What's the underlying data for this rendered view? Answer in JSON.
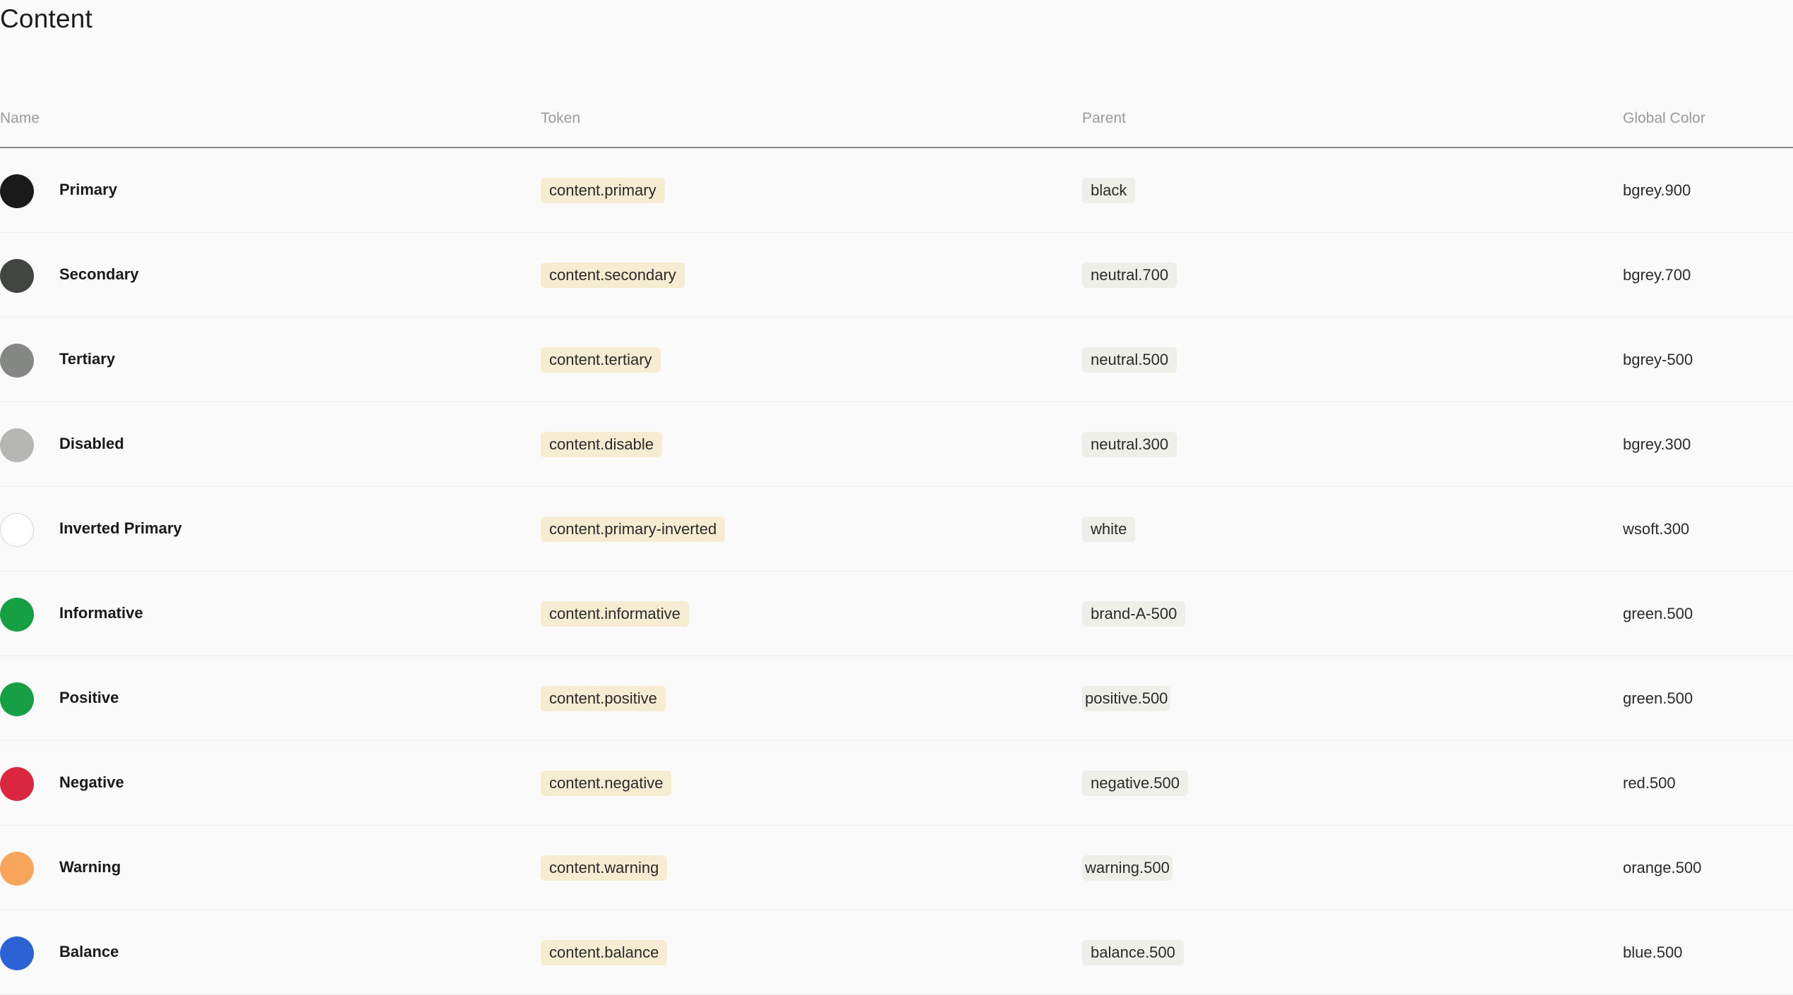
{
  "page": {
    "title": "Content"
  },
  "columns": {
    "name": "Name",
    "token": "Token",
    "parent": "Parent",
    "global": "Global Color"
  },
  "rows": [
    {
      "name": "Primary",
      "token": "content.primary",
      "parent": "black",
      "global": "bgrey.900",
      "swatch": "#1a1a1a"
    },
    {
      "name": "Secondary",
      "token": "content.secondary",
      "parent": "neutral.700",
      "global": "bgrey.700",
      "swatch": "#434543"
    },
    {
      "name": "Tertiary",
      "token": "content.tertiary",
      "parent": "neutral.500",
      "global": "bgrey-500",
      "swatch": "#858784"
    },
    {
      "name": "Disabled",
      "token": "content.disable",
      "parent": "neutral.300",
      "global": "bgrey.300",
      "swatch": "#b6b7b4"
    },
    {
      "name": "Inverted Primary",
      "token": "content.primary-inverted",
      "parent": "white",
      "global": "wsoft.300",
      "swatch": "#ffffff"
    },
    {
      "name": "Informative",
      "token": "content.informative",
      "parent": "brand-A-500",
      "global": "green.500",
      "swatch": "#16a043"
    },
    {
      "name": "Positive",
      "token": "content.positive",
      "parent": "positive.500",
      "global": "green.500",
      "swatch": "#16a043"
    },
    {
      "name": "Negative",
      "token": "content.negative",
      "parent": "negative.500",
      "global": "red.500",
      "swatch": "#db2640"
    },
    {
      "name": "Warning",
      "token": "content.warning",
      "parent": "warning.500",
      "global": "orange.500",
      "swatch": "#f6a55a"
    },
    {
      "name": "Balance",
      "token": "content.balance",
      "parent": "balance.500",
      "global": "blue.500",
      "swatch": "#2c63d4"
    }
  ],
  "colors": {
    "token_chip_bg": "#f6ecd2",
    "parent_chip_bg": "#efefea",
    "header_divider": "#8a8a8a"
  }
}
